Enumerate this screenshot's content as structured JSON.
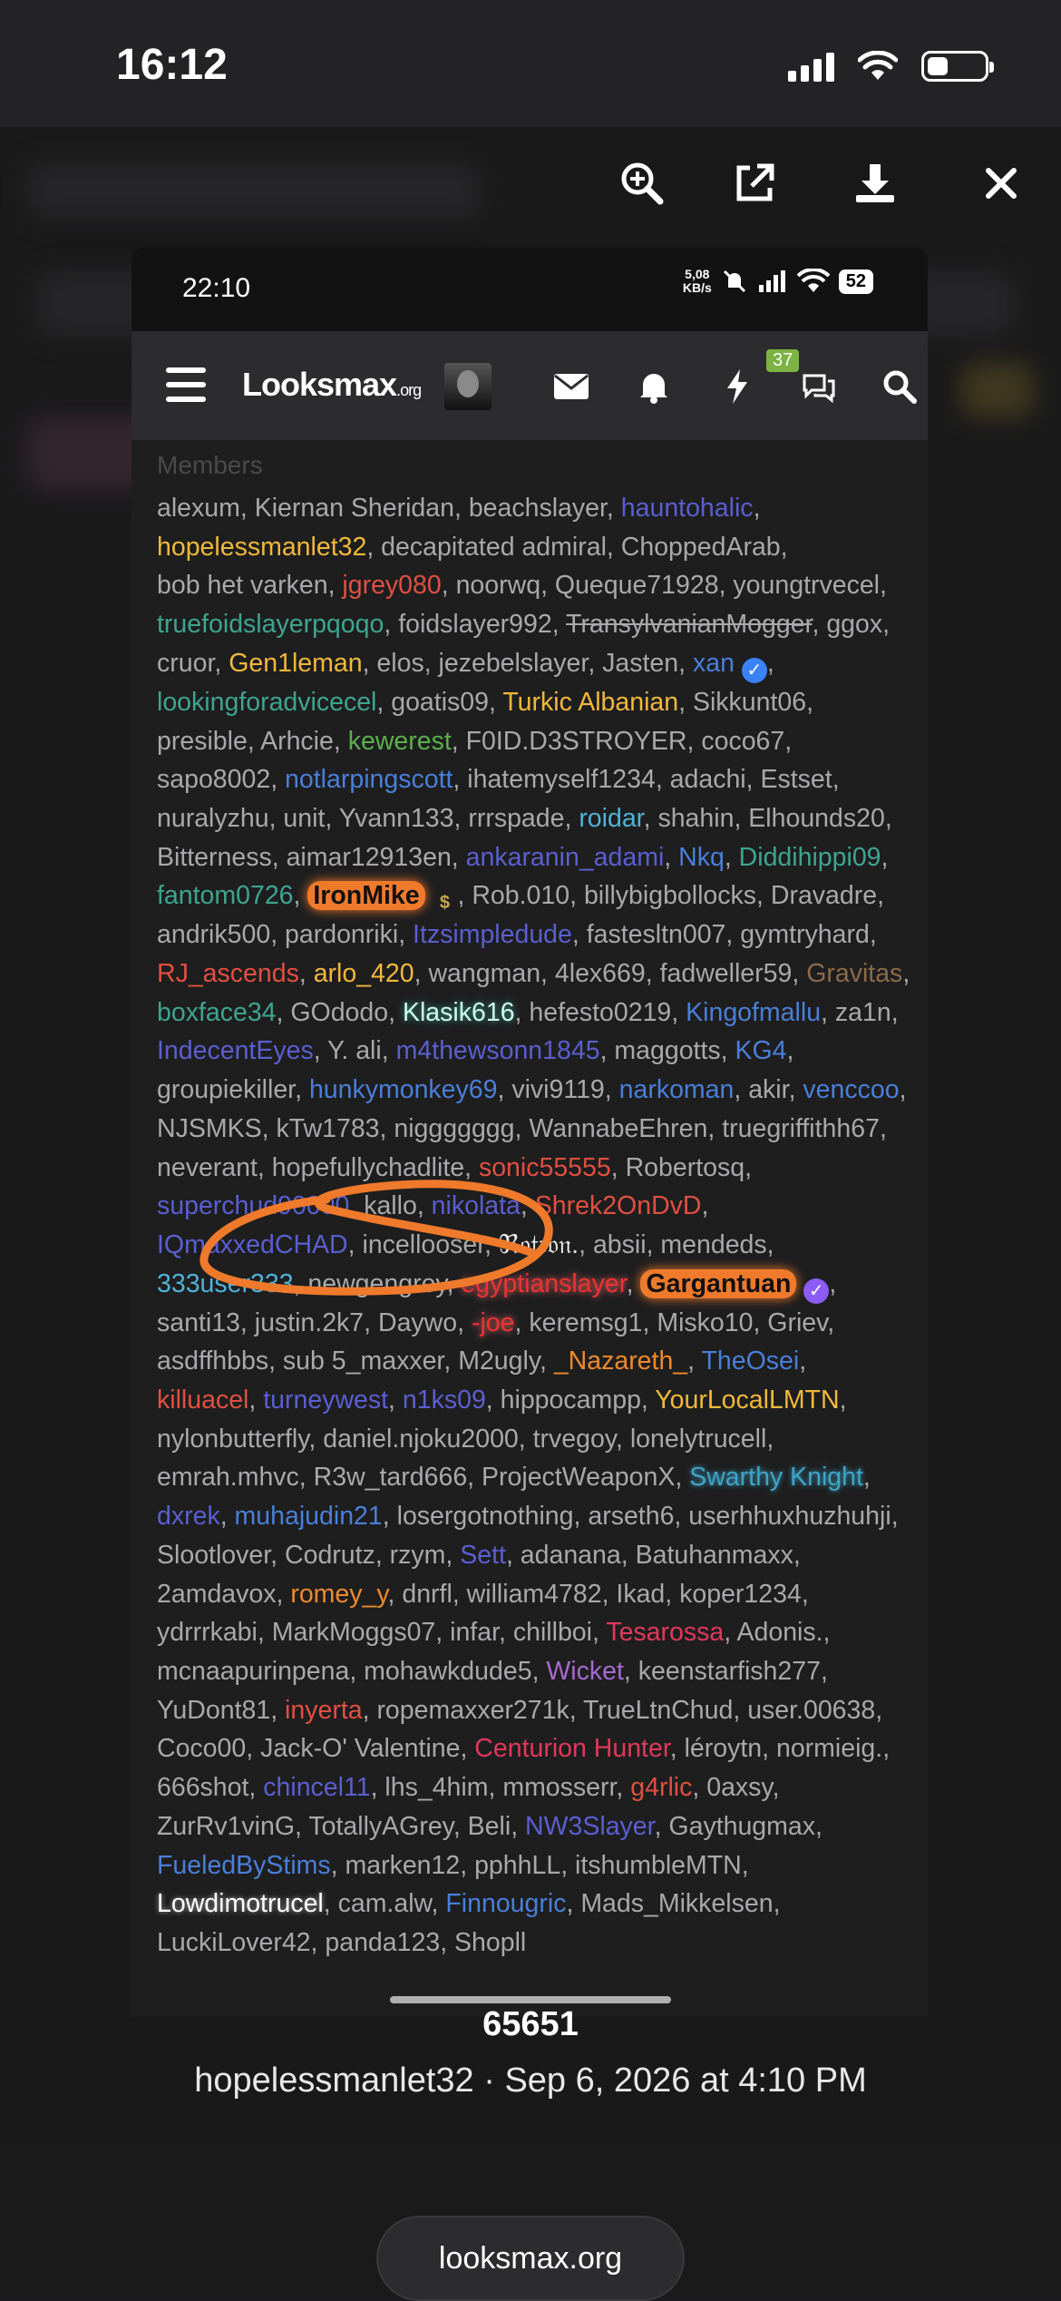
{
  "ios_status": {
    "time": "16:12"
  },
  "viewer_toolbar": {
    "icons": [
      "zoom-in-icon",
      "share-external-icon",
      "download-icon",
      "close-icon"
    ]
  },
  "phone": {
    "status": {
      "time": "22:10",
      "speed_value": "5,08",
      "speed_unit": "KB/s",
      "battery": "52"
    },
    "header": {
      "logo_main": "Looksmax",
      "logo_suffix": ".org",
      "chat_badge": "37"
    },
    "members_label": "Members",
    "members": [
      {
        "t": "alexum"
      },
      {
        "t": "Kiernan Sheridan"
      },
      {
        "t": "beachslayer"
      },
      {
        "t": "hauntohalic",
        "c": "indigo"
      },
      {
        "t": "hopelessmanlet32",
        "c": "yellow"
      },
      {
        "t": "decapitated admiral"
      },
      {
        "t": "ChoppedArab"
      },
      {
        "t": "bob het varken"
      },
      {
        "t": "jgrey080",
        "c": "red"
      },
      {
        "t": "noorwq"
      },
      {
        "t": "Queque71928"
      },
      {
        "t": "youngtrvecel"
      },
      {
        "t": "truefoidslayerpqoqo",
        "c": "teal"
      },
      {
        "t": "foidslayer992"
      },
      {
        "t": "TransylvanianMogger",
        "c": "strike"
      },
      {
        "t": "ggox"
      },
      {
        "t": "cruor"
      },
      {
        "t": "Gen1leman",
        "c": "yellow"
      },
      {
        "t": "elos"
      },
      {
        "t": "jezebelslayer"
      },
      {
        "t": "Jasten"
      },
      {
        "t": "xan",
        "c": "blue",
        "badge": "blue"
      },
      {
        "t": "lookingforadvicecel",
        "c": "teal"
      },
      {
        "t": "goatis09"
      },
      {
        "t": "Turkic Albanian",
        "c": "yellow"
      },
      {
        "t": "Sikkunt06"
      },
      {
        "t": "presible"
      },
      {
        "t": "Arhcie"
      },
      {
        "t": "kewerest",
        "c": "green"
      },
      {
        "t": "F0ID.D3STROYER"
      },
      {
        "t": "coco67"
      },
      {
        "t": "sapo8002"
      },
      {
        "t": "notlarpingscott",
        "c": "blue"
      },
      {
        "t": "ihatemyself1234"
      },
      {
        "t": "adachi"
      },
      {
        "t": "Estset"
      },
      {
        "t": "nuralyzhu"
      },
      {
        "t": "unit"
      },
      {
        "t": "Yvann133"
      },
      {
        "t": "rrrspade"
      },
      {
        "t": "roidar",
        "c": "cyan"
      },
      {
        "t": "shahin"
      },
      {
        "t": "Elhounds20"
      },
      {
        "t": "Bitterness"
      },
      {
        "t": "aimar12913en"
      },
      {
        "t": "ankaranin_adami",
        "c": "indigo"
      },
      {
        "t": "Nkq",
        "c": "blue"
      },
      {
        "t": "Diddihippi09",
        "c": "teal"
      },
      {
        "t": "fantom0726",
        "c": "teal"
      },
      {
        "t": "IronMike",
        "c": "ironmike",
        "badge": "dollar"
      },
      {
        "t": "Rob.010"
      },
      {
        "t": "billybigbollocks"
      },
      {
        "t": "Dravadre"
      },
      {
        "t": "andrik500"
      },
      {
        "t": "pardonriki"
      },
      {
        "t": "Itzsimpledude",
        "c": "indigo"
      },
      {
        "t": "fastesltn007"
      },
      {
        "t": "gymtryhard"
      },
      {
        "t": "RJ_ascends",
        "c": "red"
      },
      {
        "t": "arlo_420",
        "c": "yellow"
      },
      {
        "t": "wangman"
      },
      {
        "t": "4lex669"
      },
      {
        "t": "fadweller59"
      },
      {
        "t": "Gravitas",
        "c": "brown"
      },
      {
        "t": "boxface34",
        "c": "teal"
      },
      {
        "t": "GOdodo"
      },
      {
        "t": "Klasik616",
        "c": "klasik"
      },
      {
        "t": "hefesto0219"
      },
      {
        "t": "Kingofmallu",
        "c": "blue"
      },
      {
        "t": "za1n"
      },
      {
        "t": "IndecentEyes",
        "c": "indigo"
      },
      {
        "t": "Y. ali"
      },
      {
        "t": "m4thewsonn1845",
        "c": "indigo"
      },
      {
        "t": "maggotts"
      },
      {
        "t": "KG4",
        "c": "blue"
      },
      {
        "t": "groupiekiller"
      },
      {
        "t": "hunkymonkey69",
        "c": "blue"
      },
      {
        "t": "vivi9119"
      },
      {
        "t": "narkoman",
        "c": "blue"
      },
      {
        "t": "akir"
      },
      {
        "t": "venccoo",
        "c": "blue"
      },
      {
        "t": "NJSMKS"
      },
      {
        "t": "kTw1783"
      },
      {
        "t": "niggggggg"
      },
      {
        "t": "WannabeEhren"
      },
      {
        "t": "truegriffithh67"
      },
      {
        "t": "neverant"
      },
      {
        "t": "hopefullychadlite"
      },
      {
        "t": "sonic55555",
        "c": "red"
      },
      {
        "t": "Robertosq"
      },
      {
        "t": "superchud90000",
        "c": "indigo"
      },
      {
        "t": "kallo"
      },
      {
        "t": "nikolata",
        "c": "indigo"
      },
      {
        "t": "Shrek2OnDvD",
        "c": "red"
      },
      {
        "t": "IQmaxxedCHAD",
        "c": "indigo"
      },
      {
        "t": "incellooser"
      },
      {
        "t": "ℜ𝔬𝔱𝔯𝔬𝔫.",
        "c": "white"
      },
      {
        "t": "absii"
      },
      {
        "t": "mendeds"
      },
      {
        "t": "333user333",
        "c": "cyan"
      },
      {
        "t": "newgengrey"
      },
      {
        "t": "egyptianslayer",
        "c": "egypt"
      },
      {
        "t": "Gargantuan",
        "c": "garg",
        "badge": "purple"
      },
      {
        "t": "santi13"
      },
      {
        "t": "justin.2k7"
      },
      {
        "t": "Daywo"
      },
      {
        "t": "-joe",
        "c": "egypt"
      },
      {
        "t": "keremsg1"
      },
      {
        "t": "Misko10"
      },
      {
        "t": "Griev"
      },
      {
        "t": "asdffhbbs"
      },
      {
        "t": "sub 5_maxxer"
      },
      {
        "t": "M2ugly"
      },
      {
        "t": "_Nazareth_",
        "c": "orange"
      },
      {
        "t": "TheOsei",
        "c": "blue"
      },
      {
        "t": "killuacel",
        "c": "red"
      },
      {
        "t": "turneywest",
        "c": "indigo"
      },
      {
        "t": "n1ks09",
        "c": "indigo"
      },
      {
        "t": "hippocampp"
      },
      {
        "t": "YourLocalLMTN",
        "c": "yellow"
      },
      {
        "t": "nylonbutterfly"
      },
      {
        "t": "daniel.njoku2000"
      },
      {
        "t": "trvegoy"
      },
      {
        "t": "lonelytrucell"
      },
      {
        "t": "emrah.mhvc"
      },
      {
        "t": "R3w_tard666"
      },
      {
        "t": "ProjectWeaponX"
      },
      {
        "t": "Swarthy Knight",
        "c": "swarthy"
      },
      {
        "t": "dxrek",
        "c": "indigo"
      },
      {
        "t": "muhajudin21",
        "c": "blue"
      },
      {
        "t": "losergotnothing"
      },
      {
        "t": "arseth6"
      },
      {
        "t": "userhhuxhuzhuhji"
      },
      {
        "t": "Slootlover"
      },
      {
        "t": "Codrutz"
      },
      {
        "t": "rzym"
      },
      {
        "t": "Sett",
        "c": "indigo"
      },
      {
        "t": "adanana"
      },
      {
        "t": "Batuhanmaxx"
      },
      {
        "t": "2amdavox"
      },
      {
        "t": "romey_y",
        "c": "orange"
      },
      {
        "t": "dnrfl"
      },
      {
        "t": "william4782"
      },
      {
        "t": "Ikad"
      },
      {
        "t": "koper1234"
      },
      {
        "t": "ydrrrkabi"
      },
      {
        "t": "MarkMoggs07"
      },
      {
        "t": "infar"
      },
      {
        "t": "chillboi"
      },
      {
        "t": "Tesarossa",
        "c": "pink"
      },
      {
        "t": "Adonis."
      },
      {
        "t": "mcnaapurinpena"
      },
      {
        "t": "mohawkdude5"
      },
      {
        "t": "Wicket",
        "c": "purple"
      },
      {
        "t": "keenstarfish277"
      },
      {
        "t": "YuDont81"
      },
      {
        "t": "inyerta",
        "c": "red"
      },
      {
        "t": "ropemaxxer271k"
      },
      {
        "t": "TrueLtnChud"
      },
      {
        "t": "user.00638"
      },
      {
        "t": "Coco00"
      },
      {
        "t": "Jack-O' Valentine"
      },
      {
        "t": "Centurion Hunter",
        "c": "pink"
      },
      {
        "t": "léroytn"
      },
      {
        "t": "normieig."
      },
      {
        "t": "666shot"
      },
      {
        "t": "chincel11",
        "c": "indigo"
      },
      {
        "t": "lhs_4him"
      },
      {
        "t": "mmosserr"
      },
      {
        "t": "g4rlic",
        "c": "red"
      },
      {
        "t": "0axsy"
      },
      {
        "t": "ZurRv1vinG"
      },
      {
        "t": "TotallyAGrey"
      },
      {
        "t": "Beli"
      },
      {
        "t": "NW3Slayer",
        "c": "indigo"
      },
      {
        "t": "Gaythugmax"
      },
      {
        "t": "FueledByStims",
        "c": "blue"
      },
      {
        "t": "marken12"
      },
      {
        "t": "pphhLL"
      },
      {
        "t": "itshumbleMTN"
      },
      {
        "t": "Lowdimotrucel",
        "c": "lowdim"
      },
      {
        "t": "cam.alw"
      },
      {
        "t": "Finnougric",
        "c": "blue"
      },
      {
        "t": "Mads_Mikkelsen"
      },
      {
        "t": "LuckiLover42"
      },
      {
        "t": "panda123"
      },
      {
        "t": "Shopll"
      }
    ]
  },
  "caption": {
    "count": "65651",
    "meta": "hopelessmanlet32 · Sep 6, 2026 at 4:10 PM"
  },
  "footer": {
    "domain": "looksmax.org"
  }
}
